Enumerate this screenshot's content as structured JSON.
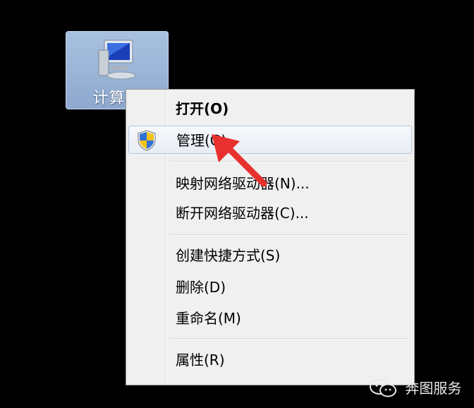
{
  "desktop_icon": {
    "label": "计算机",
    "icon": "computer-icon"
  },
  "context_menu": {
    "items": [
      {
        "label": "打开(O)",
        "bold": true
      },
      {
        "label": "管理(G)",
        "icon": "uac-shield-icon",
        "highlighted": true
      },
      {
        "label": "映射网络驱动器(N)..."
      },
      {
        "label": "断开网络驱动器(C)..."
      },
      {
        "label": "创建快捷方式(S)"
      },
      {
        "label": "删除(D)"
      },
      {
        "label": "重命名(M)"
      },
      {
        "label": "属性(R)"
      }
    ]
  },
  "annotation": {
    "icon": "red-arrow-icon",
    "color": "#e8312f"
  },
  "watermark": {
    "text": "奔图服务",
    "icon": "wechat-icon"
  }
}
